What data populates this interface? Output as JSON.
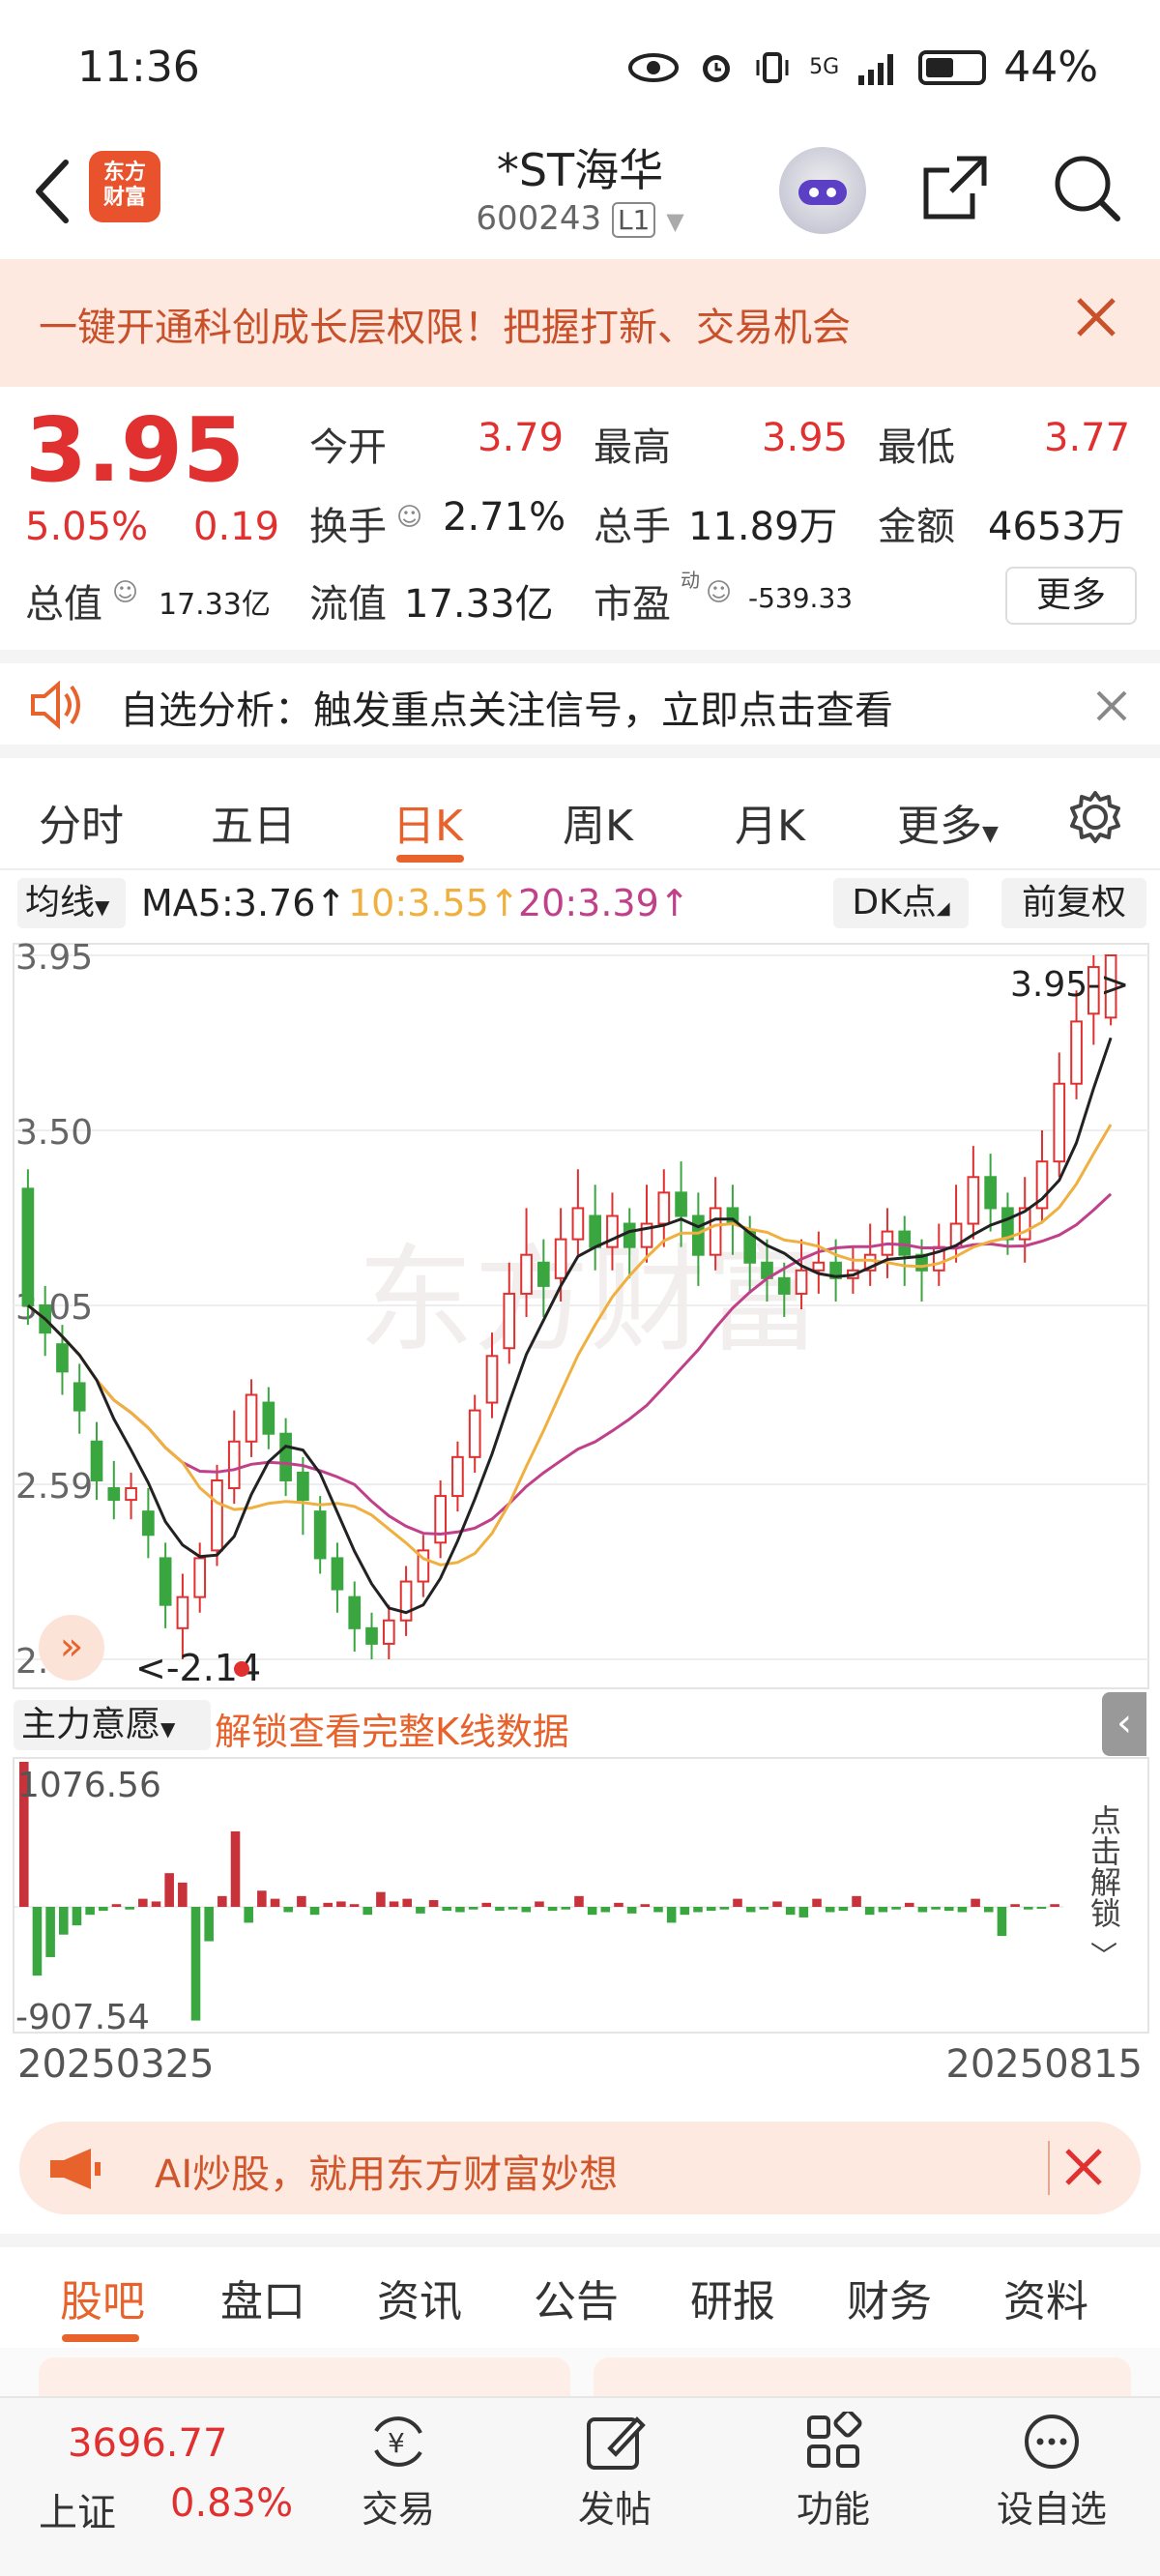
{
  "status_bar": {
    "time": "11:36",
    "network": "5G",
    "battery": "44%"
  },
  "header": {
    "logo_text": "东方\n财富",
    "stock_name": "*ST海华",
    "stock_code": "600243",
    "level": "L1"
  },
  "promo": {
    "text": "一键开通科创成长层权限！把握打新、交易机会"
  },
  "quote": {
    "price": "3.95",
    "change_pct": "5.05%",
    "change": "0.19",
    "open_label": "今开",
    "open": "3.79",
    "high_label": "最高",
    "high": "3.95",
    "low_label": "最低",
    "low": "3.77",
    "turnover_label": "换手",
    "turnover": "2.71%",
    "volume_label": "总手",
    "volume": "11.89万",
    "amount_label": "金额",
    "amount": "4653万",
    "mcap_label": "总值",
    "mcap": "17.33亿",
    "float_label": "流值",
    "float": "17.33亿",
    "pe_label": "市盈",
    "pe_sup": "动",
    "pe": "-539.33",
    "more_label": "更多"
  },
  "analysis": {
    "text": "自选分析：触发重点关注信号，立即点击查看"
  },
  "kline_tabs": [
    {
      "label": "分时"
    },
    {
      "label": "五日"
    },
    {
      "label": "日K"
    },
    {
      "label": "周K"
    },
    {
      "label": "月K"
    },
    {
      "label": "更多"
    }
  ],
  "ma_row": {
    "select": "均线",
    "ma5": "MA5:3.76↑",
    "ma10": "10:3.55↑",
    "ma20": "20:3.39↑",
    "dk": "DK点",
    "adjust": "前复权"
  },
  "colors": {
    "up": "#e03030",
    "down": "#3aa640",
    "ma5": "#222222",
    "ma10": "#f0b040",
    "ma20": "#c0408a",
    "accent": "#e8622c"
  },
  "chart_data": {
    "type": "candlestick",
    "y_labels": [
      "3.95",
      "3.50",
      "3.05",
      "2.59",
      "2.14"
    ],
    "ylim": [
      2.14,
      3.95
    ],
    "max_marker": "3.95->",
    "min_marker": "<-2.14",
    "start_date": "20250325",
    "end_date": "20250815",
    "candles": [
      [
        3.35,
        3.05,
        3.4,
        3.0
      ],
      [
        3.05,
        2.98,
        3.1,
        2.92
      ],
      [
        2.95,
        2.88,
        3.0,
        2.82
      ],
      [
        2.85,
        2.78,
        2.9,
        2.72
      ],
      [
        2.7,
        2.6,
        2.75,
        2.55
      ],
      [
        2.58,
        2.55,
        2.65,
        2.5
      ],
      [
        2.55,
        2.58,
        2.62,
        2.5
      ],
      [
        2.52,
        2.46,
        2.58,
        2.4
      ],
      [
        2.4,
        2.28,
        2.44,
        2.22
      ],
      [
        2.22,
        2.3,
        2.36,
        2.14
      ],
      [
        2.3,
        2.4,
        2.44,
        2.26
      ],
      [
        2.42,
        2.6,
        2.64,
        2.38
      ],
      [
        2.58,
        2.7,
        2.78,
        2.54
      ],
      [
        2.7,
        2.82,
        2.86,
        2.66
      ],
      [
        2.8,
        2.72,
        2.84,
        2.68
      ],
      [
        2.72,
        2.6,
        2.76,
        2.56
      ],
      [
        2.62,
        2.55,
        2.66,
        2.46
      ],
      [
        2.52,
        2.4,
        2.56,
        2.36
      ],
      [
        2.4,
        2.32,
        2.44,
        2.26
      ],
      [
        2.3,
        2.22,
        2.34,
        2.16
      ],
      [
        2.22,
        2.18,
        2.26,
        2.14
      ],
      [
        2.18,
        2.24,
        2.28,
        2.14
      ],
      [
        2.24,
        2.34,
        2.38,
        2.2
      ],
      [
        2.34,
        2.42,
        2.46,
        2.3
      ],
      [
        2.44,
        2.56,
        2.6,
        2.4
      ],
      [
        2.56,
        2.66,
        2.7,
        2.52
      ],
      [
        2.66,
        2.78,
        2.82,
        2.62
      ],
      [
        2.8,
        2.92,
        2.98,
        2.76
      ],
      [
        2.94,
        3.08,
        3.16,
        2.9
      ],
      [
        3.08,
        3.18,
        3.3,
        3.02
      ],
      [
        3.16,
        3.1,
        3.22,
        3.02
      ],
      [
        3.12,
        3.22,
        3.3,
        3.06
      ],
      [
        3.22,
        3.3,
        3.4,
        3.18
      ],
      [
        3.28,
        3.2,
        3.36,
        3.14
      ],
      [
        3.2,
        3.28,
        3.34,
        3.14
      ],
      [
        3.26,
        3.2,
        3.3,
        3.12
      ],
      [
        3.2,
        3.26,
        3.36,
        3.16
      ],
      [
        3.26,
        3.34,
        3.4,
        3.2
      ],
      [
        3.34,
        3.28,
        3.42,
        3.2
      ],
      [
        3.28,
        3.18,
        3.34,
        3.1
      ],
      [
        3.18,
        3.3,
        3.38,
        3.14
      ],
      [
        3.3,
        3.26,
        3.36,
        3.18
      ],
      [
        3.24,
        3.16,
        3.28,
        3.08
      ],
      [
        3.16,
        3.12,
        3.22,
        3.06
      ],
      [
        3.12,
        3.08,
        3.16,
        3.02
      ],
      [
        3.08,
        3.14,
        3.22,
        3.04
      ],
      [
        3.14,
        3.16,
        3.24,
        3.08
      ],
      [
        3.16,
        3.12,
        3.22,
        3.06
      ],
      [
        3.12,
        3.14,
        3.2,
        3.08
      ],
      [
        3.14,
        3.18,
        3.26,
        3.1
      ],
      [
        3.18,
        3.24,
        3.3,
        3.12
      ],
      [
        3.24,
        3.18,
        3.28,
        3.1
      ],
      [
        3.18,
        3.14,
        3.22,
        3.06
      ],
      [
        3.14,
        3.2,
        3.26,
        3.1
      ],
      [
        3.2,
        3.26,
        3.36,
        3.16
      ],
      [
        3.26,
        3.38,
        3.46,
        3.22
      ],
      [
        3.38,
        3.3,
        3.44,
        3.24
      ],
      [
        3.3,
        3.22,
        3.34,
        3.18
      ],
      [
        3.22,
        3.3,
        3.38,
        3.16
      ],
      [
        3.3,
        3.42,
        3.5,
        3.26
      ],
      [
        3.42,
        3.62,
        3.7,
        3.38
      ],
      [
        3.62,
        3.78,
        3.86,
        3.58
      ],
      [
        3.8,
        3.92,
        3.95,
        3.72
      ],
      [
        3.79,
        3.95,
        3.95,
        3.77
      ]
    ]
  },
  "indicator": {
    "select": "主力意愿",
    "unlock_text": "解锁查看完整K线数据",
    "top_label": "1076.56",
    "bottom_label": "-907.54",
    "side_unlock": "点击解锁",
    "bars": [
      1076,
      -520,
      -380,
      -210,
      -140,
      -60,
      -30,
      20,
      -20,
      60,
      40,
      250,
      180,
      -860,
      -260,
      80,
      560,
      -120,
      120,
      60,
      -40,
      80,
      -60,
      30,
      40,
      20,
      -60,
      110,
      40,
      60,
      -50,
      50,
      -30,
      -40,
      -20,
      30,
      -30,
      -20,
      -40,
      40,
      -30,
      -20,
      80,
      -60,
      -40,
      30,
      -50,
      20,
      -40,
      -120,
      -60,
      -40,
      -30,
      -20,
      60,
      -40,
      -20,
      40,
      -60,
      -80,
      60,
      -40,
      -30,
      80,
      -60,
      -40,
      -20,
      30,
      -40,
      -20,
      -30,
      -40,
      60,
      -40,
      -220,
      20,
      -20,
      -10,
      20
    ]
  },
  "ai_banner": {
    "text": "AI炒股，就用东方财富妙想"
  },
  "bottom_tabs": [
    {
      "label": "股吧"
    },
    {
      "label": "盘口"
    },
    {
      "label": "资讯"
    },
    {
      "label": "公告"
    },
    {
      "label": "研报"
    },
    {
      "label": "财务"
    },
    {
      "label": "资料"
    }
  ],
  "bottom_nav": {
    "index_value": "3696.77",
    "index_name": "上证",
    "index_change": "0.83%",
    "items": [
      {
        "label": "交易"
      },
      {
        "label": "发帖"
      },
      {
        "label": "功能"
      },
      {
        "label": "设自选"
      }
    ]
  }
}
